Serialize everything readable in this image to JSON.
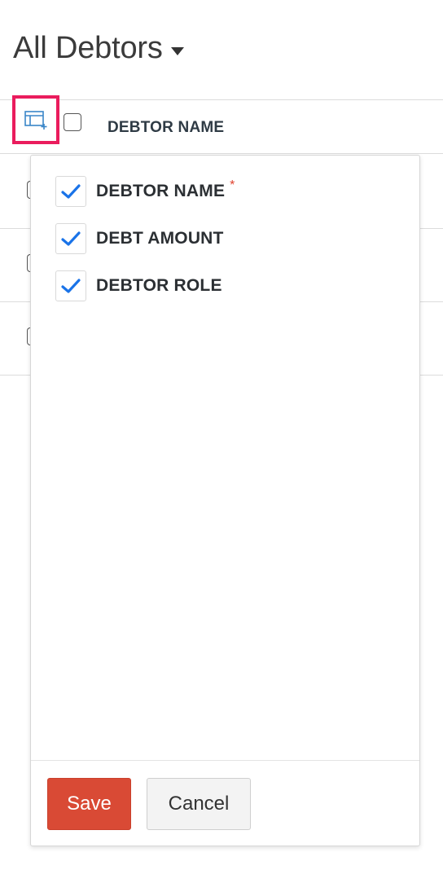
{
  "header": {
    "title": "All Debtors"
  },
  "table": {
    "column_header": "DEBTOR NAME"
  },
  "column_picker": {
    "options": [
      {
        "label": "DEBTOR NAME",
        "checked": true,
        "required": true,
        "required_mark": "*"
      },
      {
        "label": "DEBT AMOUNT",
        "checked": true,
        "required": false
      },
      {
        "label": "DEBTOR ROLE",
        "checked": true,
        "required": false
      }
    ],
    "save_label": "Save",
    "cancel_label": "Cancel"
  },
  "colors": {
    "accent_check": "#1a73e8",
    "highlight_border": "#ea1c5d",
    "save_button": "#d94a35",
    "required_mark": "#e0422f",
    "icon_blue": "#3a86c8"
  },
  "icons": {
    "column_config": "table-add-column-icon",
    "title_caret": "caret-down-icon",
    "check": "checkmark-icon"
  }
}
